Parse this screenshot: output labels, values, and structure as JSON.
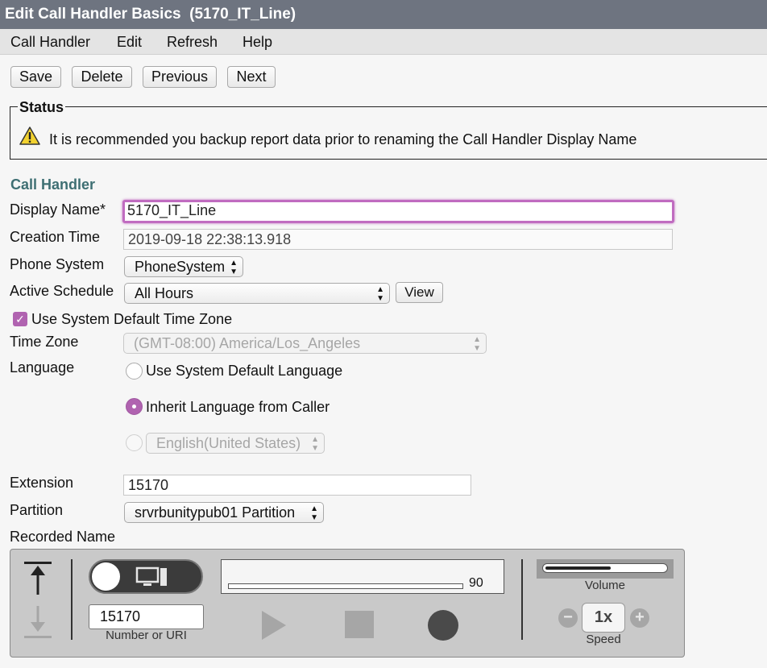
{
  "window": {
    "title": "Edit Call Handler Basics  (5170_IT_Line)"
  },
  "menu": [
    "Call Handler",
    "Edit",
    "Refresh",
    "Help"
  ],
  "toolbar": {
    "save": "Save",
    "delete": "Delete",
    "previous": "Previous",
    "next": "Next"
  },
  "status": {
    "legend": "Status",
    "icon": "warning-icon",
    "message": "It is recommended you backup report data prior to renaming the Call Handler Display Name"
  },
  "call_handler": {
    "section_title": "Call Handler",
    "display_name_label": "Display Name*",
    "display_name_value": "5170_IT_Line",
    "creation_time_label": "Creation Time",
    "creation_time_value": "2019-09-18 22:38:13.918",
    "phone_system_label": "Phone System",
    "phone_system_value": "PhoneSystem",
    "active_schedule_label": "Active Schedule",
    "active_schedule_value": "All Hours",
    "view_button": "View",
    "use_default_tz_label": "Use System Default Time Zone",
    "use_default_tz_checked": true,
    "time_zone_label": "Time Zone",
    "time_zone_value": "(GMT-08:00) America/Los_Angeles",
    "language_label": "Language",
    "language_options": [
      {
        "label": "Use System Default Language",
        "checked": false
      },
      {
        "label": "Inherit Language from Caller",
        "checked": true
      }
    ],
    "language_select_value": "English(United States)",
    "extension_label": "Extension",
    "extension_value": "15170",
    "partition_label": "Partition",
    "partition_value": "srvrbunitypub01 Partition",
    "recorded_name_label": "Recorded Name"
  },
  "player": {
    "progress_value": "90",
    "number_value": "15170",
    "number_caption": "Number or URI",
    "volume_caption": "Volume",
    "volume_level": 0.55,
    "speed_value": "1x",
    "speed_caption": "Speed"
  },
  "colors": {
    "accent": "#b063b0",
    "title_bar": "#6e7480",
    "section_title": "#3e6f73"
  }
}
